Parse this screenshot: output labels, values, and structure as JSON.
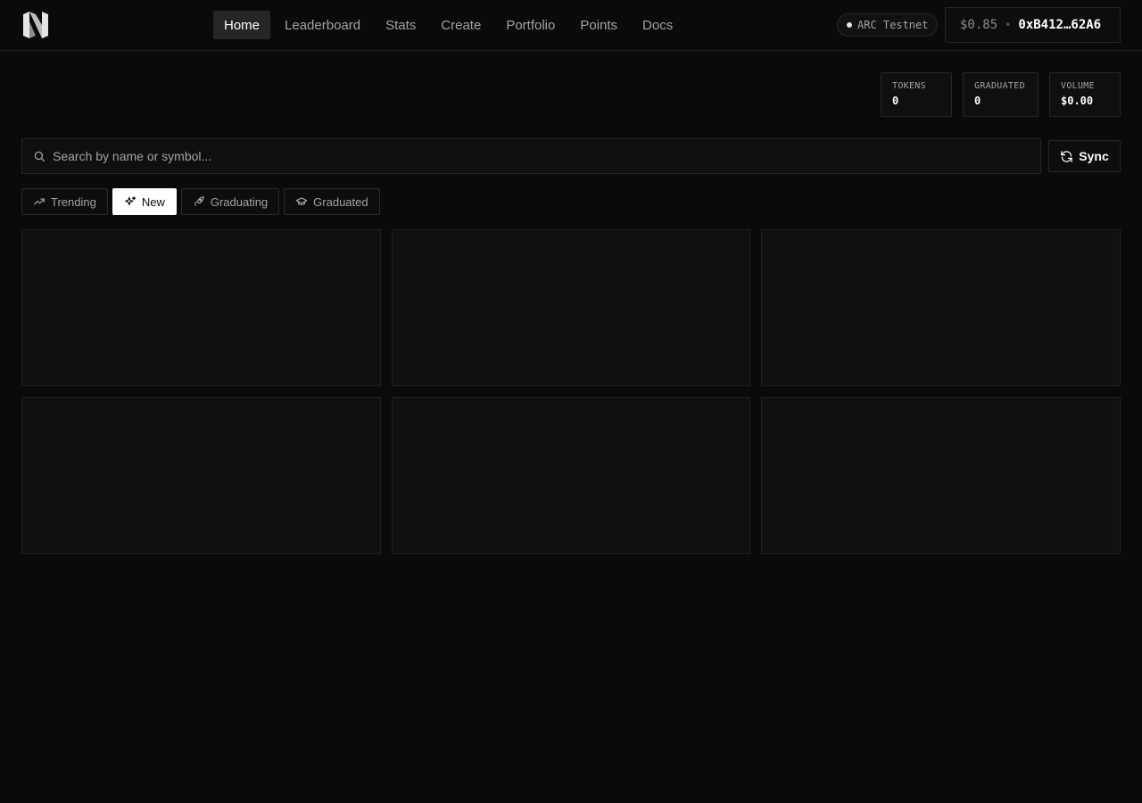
{
  "header": {
    "nav": [
      {
        "label": "Home",
        "active": true
      },
      {
        "label": "Leaderboard"
      },
      {
        "label": "Stats"
      },
      {
        "label": "Create"
      },
      {
        "label": "Portfolio"
      },
      {
        "label": "Points"
      },
      {
        "label": "Docs"
      }
    ],
    "network": "ARC Testnet",
    "wallet": {
      "price": "$0.85",
      "separator": "•",
      "address": "0xB412…62A6"
    }
  },
  "stats": [
    {
      "label": "TOKENS",
      "value": "0"
    },
    {
      "label": "GRADUATED",
      "value": "0"
    },
    {
      "label": "VOLUME",
      "value": "$0.00"
    }
  ],
  "search": {
    "placeholder": "Search by name or symbol..."
  },
  "sync_label": "Sync",
  "filters": [
    {
      "label": "Trending",
      "icon": "trending-up-icon"
    },
    {
      "label": "New",
      "icon": "sparkles-icon",
      "active": true
    },
    {
      "label": "Graduating",
      "icon": "rocket-icon"
    },
    {
      "label": "Graduated",
      "icon": "graduation-cap-icon"
    }
  ],
  "colors": {
    "background": "#0a0a0a",
    "card": "#101010",
    "border": "#262626",
    "accent": "#ffffff"
  }
}
